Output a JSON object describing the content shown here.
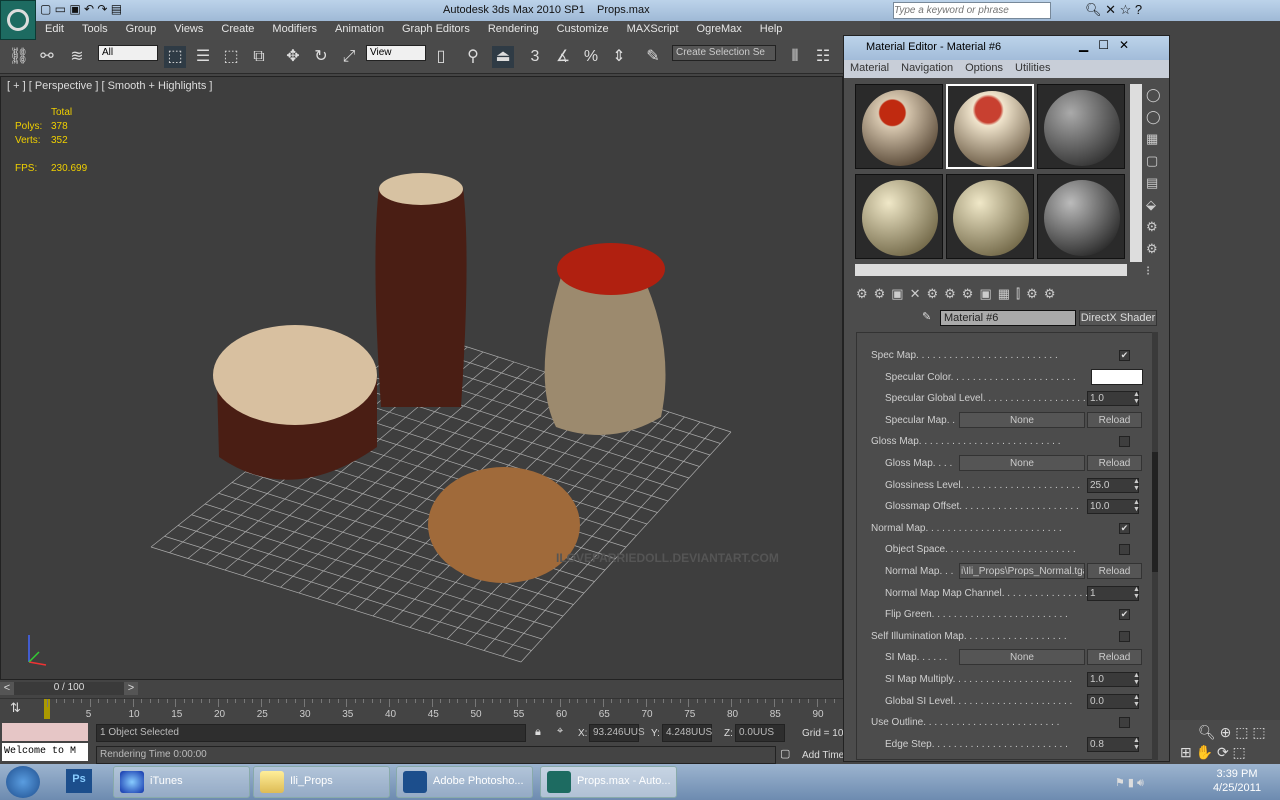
{
  "window": {
    "app_title": "Autodesk 3ds Max  2010 SP1",
    "file": "Props.max",
    "search_placeholder": "Type a keyword or phrase"
  },
  "menu": [
    "Edit",
    "Tools",
    "Group",
    "Views",
    "Create",
    "Modifiers",
    "Animation",
    "Graph Editors",
    "Rendering",
    "Customize",
    "MAXScript",
    "OgreMax",
    "Help"
  ],
  "toolbar": {
    "filter": "All",
    "coord": "View",
    "snap_label": "3",
    "selection_set": "Create Selection Se"
  },
  "viewport": {
    "label": "[ + ] [ Perspective ] [ Smooth + Highlights ]",
    "stats_header": "Total",
    "polys_label": "Polys:",
    "polys": "378",
    "verts_label": "Verts:",
    "verts": "352",
    "fps_label": "FPS:",
    "fps": "230.699",
    "watermark": "ILOVEPARRIEDOLL.DEVIANTART.COM"
  },
  "timeline": {
    "frame": "0 / 100",
    "ticks": [
      "5",
      "10",
      "15",
      "20",
      "25",
      "30",
      "35",
      "40",
      "45",
      "50",
      "55",
      "60",
      "65",
      "70",
      "75",
      "80",
      "85",
      "90"
    ]
  },
  "status": {
    "maxscript": "Welcome to M",
    "selected": "1 Object Selected",
    "rendering_time": "Rendering Time  0:00:00",
    "x_label": "X:",
    "x": "93.246UUS",
    "y_label": "Y:",
    "y": "4.248UUS",
    "z_label": "Z:",
    "z": "0.0UUS",
    "grid": "Grid = 10",
    "add_time": "Add Time"
  },
  "material_editor": {
    "title": "Material Editor - Material #6",
    "menu": [
      "Material",
      "Navigation",
      "Options",
      "Utilities"
    ],
    "material_name": "Material #6",
    "shader_button": "DirectX Shader",
    "params": [
      {
        "label": "Spec Map. . . . . . . . . . . . . . . . . . . . . . . . . .",
        "indent": 0,
        "type": "check",
        "checked": true
      },
      {
        "label": "Specular Color. . . . . . . . . . . . . . . . . . . . . . .",
        "indent": 1,
        "type": "color",
        "color": "#ffffff"
      },
      {
        "label": "Specular Global Level. . . . . . . . . . . . . . . . . . .",
        "indent": 1,
        "type": "spin",
        "value": "1.0"
      },
      {
        "label": "Specular Map. .",
        "indent": 1,
        "type": "map",
        "value": "None",
        "reload": "Reload"
      },
      {
        "label": "Gloss Map. . . . . . . . . . . . . . . . . . . . . . . . . .",
        "indent": 0,
        "type": "check",
        "checked": false
      },
      {
        "label": "Gloss Map. . . .",
        "indent": 1,
        "type": "map",
        "value": "None",
        "reload": "Reload"
      },
      {
        "label": "Glossiness Level. . . . . . . . . . . . . . . . . . . . . .",
        "indent": 1,
        "type": "spin",
        "value": "25.0"
      },
      {
        "label": "Glossmap Offset. . . . . . . . . . . . . . . . . . . . . .",
        "indent": 1,
        "type": "spin",
        "value": "10.0"
      },
      {
        "label": "Normal Map. . . . . . . . . . . . . . . . . . . . . . . . .",
        "indent": 0,
        "type": "check",
        "checked": true
      },
      {
        "label": "Object Space. . . . . . . . . . . . . . . . . . . . . . . .",
        "indent": 1,
        "type": "check",
        "checked": false
      },
      {
        "label": "Normal Map. . .",
        "indent": 1,
        "type": "map",
        "value": "i\\Ili_Props\\Props_Normal.tga",
        "reload": "Reload"
      },
      {
        "label": "Normal Map Map Channel. . . . . . . . . . . . . . . .",
        "indent": 1,
        "type": "spin",
        "value": "1"
      },
      {
        "label": "Flip Green. . . . . . . . . . . . . . . . . . . . . . . . .",
        "indent": 1,
        "type": "check",
        "checked": true
      },
      {
        "label": "Self Illumination Map. . . . . . . . . . . . . . . . . . .",
        "indent": 0,
        "type": "check",
        "checked": false
      },
      {
        "label": "SI Map. . . . . .",
        "indent": 1,
        "type": "map",
        "value": "None",
        "reload": "Reload"
      },
      {
        "label": "SI Map Multiply. . . . . . . . . . . . . . . . . . . . . .",
        "indent": 1,
        "type": "spin",
        "value": "1.0"
      },
      {
        "label": "Global SI Level. . . . . . . . . . . . . . . . . . . . . .",
        "indent": 1,
        "type": "spin",
        "value": "0.0"
      },
      {
        "label": "Use Outline. . . . . . . . . . . . . . . . . . . . . . . . .",
        "indent": 0,
        "type": "check",
        "checked": false
      },
      {
        "label": "Edge Step. . . . . . . . . . . . . . . . . . . . . . . . .",
        "indent": 1,
        "type": "spin",
        "value": "0.8"
      }
    ]
  },
  "taskbar": {
    "items": [
      "iTunes",
      "Ili_Props",
      "Adobe Photosho...",
      "Props.max - Auto..."
    ],
    "time": "3:39 PM",
    "date": "4/25/2011"
  }
}
